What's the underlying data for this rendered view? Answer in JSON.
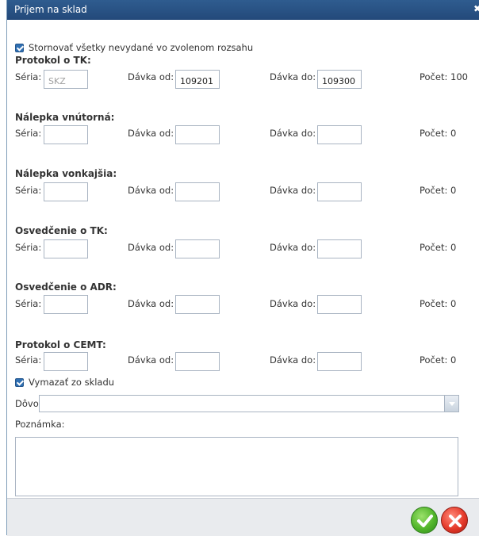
{
  "window": {
    "title": "Príjem na sklad",
    "close_glyph": "✖"
  },
  "stornovat": {
    "label": "Stornovať všetky nevydané vo zvolenom rozsahu",
    "checked": true
  },
  "labels": {
    "seria": "Séria:",
    "davka_od": "Dávka od:",
    "davka_do": "Dávka do:"
  },
  "sections": [
    {
      "title": "Protokol o TK:",
      "seria": "SKZ",
      "davka_od": "109201",
      "davka_do": "109300",
      "pocet": "Počet: 100"
    },
    {
      "title": "Nálepka vnútorná:",
      "seria": "",
      "davka_od": "",
      "davka_do": "",
      "pocet": "Počet: 0"
    },
    {
      "title": "Nálepka vonkajšia:",
      "seria": "",
      "davka_od": "",
      "davka_do": "",
      "pocet": "Počet: 0"
    },
    {
      "title": "Osvedčenie o TK:",
      "seria": "",
      "davka_od": "",
      "davka_do": "",
      "pocet": "Počet: 0"
    },
    {
      "title": "Osvedčenie o ADR:",
      "seria": "",
      "davka_od": "",
      "davka_do": "",
      "pocet": "Počet: 0"
    },
    {
      "title": "Protokol o CEMT:",
      "seria": "",
      "davka_od": "",
      "davka_do": "",
      "pocet": "Počet: 0"
    }
  ],
  "vymazat": {
    "label": "Vymazať zo skladu",
    "checked": true
  },
  "dovod": {
    "label": "Dôvod:",
    "value": ""
  },
  "poznamka": {
    "label": "Poznámka:",
    "value": ""
  },
  "colors": {
    "titlebar": "#2f5c8f",
    "checkbox": "#2f6fb2",
    "ok": "#52b52b",
    "cancel": "#e53a2a"
  },
  "icons": {
    "ok": "checkmark-icon",
    "cancel": "cross-icon",
    "close": "close-icon",
    "dropdown": "chevron-down-icon"
  }
}
